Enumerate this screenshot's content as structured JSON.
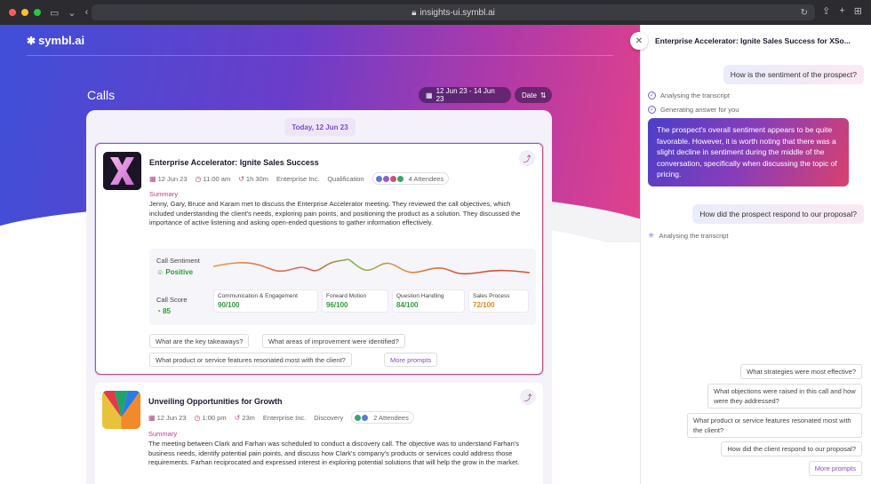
{
  "browser": {
    "url": "insights-ui.symbl.ai",
    "colors": {
      "red": "#ff5f57",
      "yellow": "#febc2e",
      "green": "#28c840"
    }
  },
  "brand": {
    "logo_text": "symbl.ai"
  },
  "page": {
    "title": "Calls",
    "date_range": "12 Jun 23 - 14 Jun 23",
    "sort_label": "Date",
    "today_label": "Today, 12 Jun 23"
  },
  "calls": [
    {
      "title": "Enterprise Accelerator: Ignite Sales Success",
      "date": "12 Jun 23",
      "time": "11:00 am",
      "duration": "1h 30m",
      "company": "Enterprise Inc.",
      "stage": "Qualification",
      "attendees": "4 Attendees",
      "summary_label": "Summary",
      "summary": "Jenny, Gary, Bruce and Karam met to discuss the Enterprise Accelerator meeting. They reviewed the call objectives, which included understanding the client's needs, exploring pain points, and positioning the product as a solution. They discussed the importance of active listening and asking open-ended questions to gather information effectively.",
      "sentiment_label": "Call Sentiment",
      "sentiment_value": "Positive",
      "score_label": "Call Score",
      "score_value": "85",
      "metrics": [
        {
          "name": "Communication & Engagement",
          "value": "90/100",
          "color": "#2f9a3e"
        },
        {
          "name": "Forward Motion",
          "value": "96/100",
          "color": "#2f9a3e"
        },
        {
          "name": "Question Handling",
          "value": "84/100",
          "color": "#2f9a3e"
        },
        {
          "name": "Sales Process",
          "value": "72/100",
          "color": "#e08a1e"
        }
      ],
      "prompts": [
        "What are the key takeaways?",
        "What areas of improvement were identified?",
        "What product or service features resonated most with the client?"
      ],
      "more_prompts": "More prompts"
    },
    {
      "title": "Unveiling Opportunities for Growth",
      "date": "12 Jun 23",
      "time": "1:00 pm",
      "duration": "23m",
      "company": "Enterprise Inc.",
      "stage": "Discovery",
      "attendees": "2 Attendees",
      "summary_label": "Summary",
      "summary": "The meeting between Clark and Farhan was scheduled to conduct a discovery call. The objective was to understand Farhan's business needs, identify potential pain points, and discuss how Clark's company's products or services could address those requirements. Farhan reciprocated and expressed interest in exploring potential solutions that will help the grow in the market."
    }
  ],
  "chat": {
    "title": "Enterprise Accelerator: Ignite Sales Success for XSo...",
    "q1": "How is the sentiment of the prospect?",
    "status1": "Analysing the transcript",
    "status2": "Generating answer for you",
    "answer": "The prospect's overall sentiment appears to be quite favorable. However, it is worth noting that there was a slight decline in sentiment during the middle of the conversation, specifically when discussing the topic of pricing.",
    "q2": "How did the prospect respond to our proposal?",
    "status3": "Analysing the transcript",
    "suggestions": [
      "What strategies were most effective?",
      "What objections were raised in this call and how were they addressed?",
      "What product or service features resonated most with the client?",
      "How did the client respond to our proposal?"
    ],
    "more_prompts": "More prompts"
  }
}
